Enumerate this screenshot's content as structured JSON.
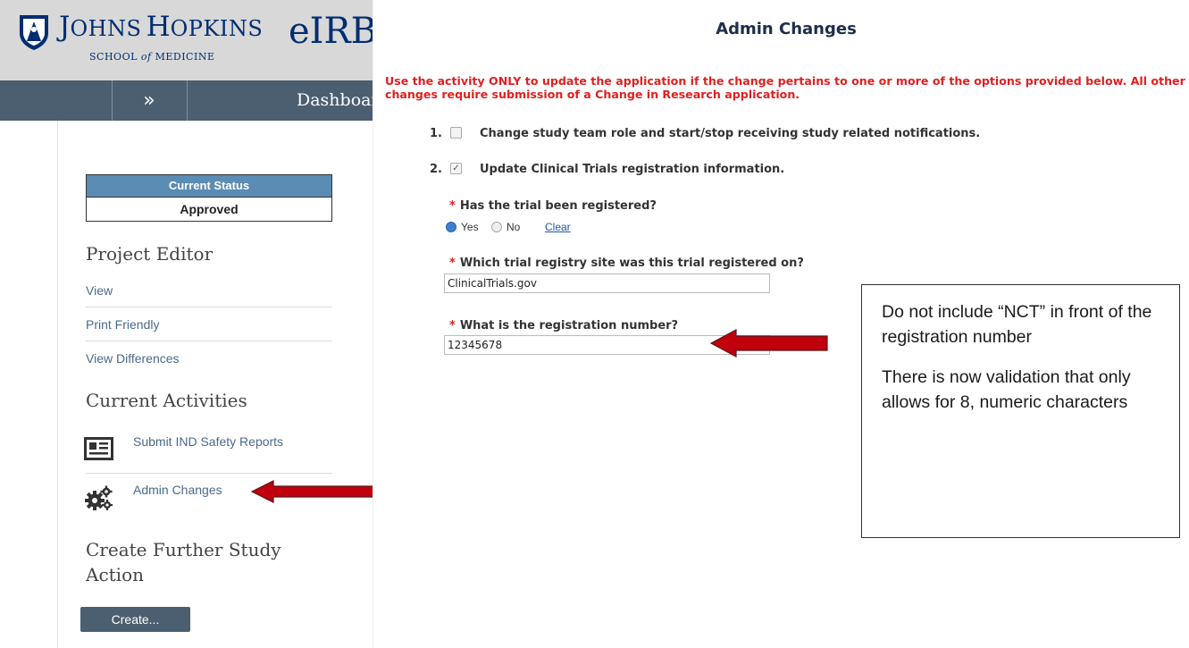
{
  "header": {
    "org_first_letter": "J",
    "org_first_rest": "OHNS",
    "org_second_letter": "H",
    "org_second_rest": "OPKINS",
    "school_prefix": "SCHOOL",
    "school_of": "of",
    "school_suffix": "MEDICINE",
    "app_name": "eIRB"
  },
  "nav": {
    "expand_label": "»",
    "dashboard_label": "Dashboard"
  },
  "status": {
    "heading": "Current Status",
    "value": "Approved"
  },
  "project_editor": {
    "heading": "Project Editor",
    "links": [
      "View",
      "Print Friendly",
      "View Differences"
    ]
  },
  "current_activities": {
    "heading": "Current Activities",
    "items": [
      {
        "label": "Submit IND Safety Reports",
        "icon": "report-icon"
      },
      {
        "label": "Admin Changes",
        "icon": "gears-icon"
      }
    ]
  },
  "further_action": {
    "heading_line1": "Create Further Study",
    "heading_line2": "Action",
    "button": "Create..."
  },
  "admin_changes": {
    "title": "Admin Changes",
    "warning": "Use the activity ONLY to update the application if the change pertains to one or more of the options provided below. All other changes require submission of a Change in Research application.",
    "options": [
      {
        "num": "1.",
        "label": "Change study team role and start/stop receiving study related notifications.",
        "checked": false
      },
      {
        "num": "2.",
        "label": "Update Clinical Trials registration information.",
        "checked": true
      }
    ],
    "q_registered": {
      "label": "Has the trial been registered?",
      "yes": "Yes",
      "no": "No",
      "clear": "Clear",
      "selected": "Yes"
    },
    "q_site": {
      "label": "Which trial registry site was this trial registered on?",
      "value": "ClinicalTrials.gov"
    },
    "q_number": {
      "label": "What is the registration number?",
      "value": "12345678"
    }
  },
  "note": {
    "p1": "Do not include “NCT” in front of the registration number",
    "p2": "There is now validation that only allows for 8, numeric characters"
  },
  "colors": {
    "nav": "#4c5f71",
    "status_header": "#5b8cb3",
    "warning": "#e02020",
    "arrow": "#c0000d",
    "brand": "#002d72"
  }
}
